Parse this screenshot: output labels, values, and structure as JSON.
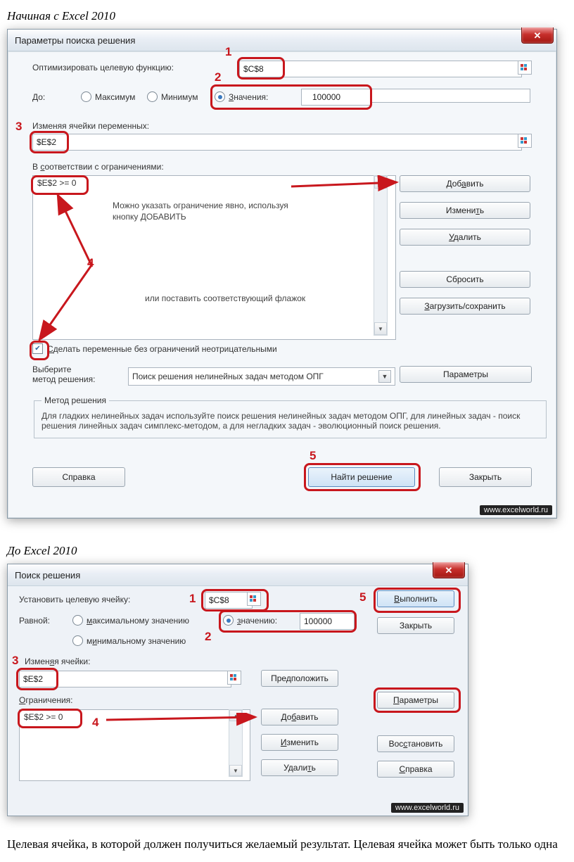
{
  "headings": {
    "after2010": "Начиная с Excel 2010",
    "before2010": "До Excel 2010",
    "bottom_text": "Целевая ячейка, в которой должен получиться желаемый результат. Целевая ячейка может быть только одна"
  },
  "dialog1": {
    "title": "Параметры поиска решения",
    "optimize_label": "Оптимизировать целевую функцию:",
    "objective_value": "$C$8",
    "to_label": "До:",
    "radio_max": "Максимум",
    "radio_min": "Минимум",
    "radio_value": "Значения:",
    "value_number": "100000",
    "vars_label": "Изменяя ячейки переменных:",
    "vars_value": "$E$2",
    "constraints_label": "В соответствии с ограничениями:",
    "constraint_item": "$E$2 >= 0",
    "ann_text1_l1": "Можно указать ограничение явно, используя",
    "ann_text1_l2": "кнопку ДОБАВИТЬ",
    "ann_text2": "или поставить соответствующий флажок",
    "checkbox_label": "Сделать переменные без ограничений неотрицательными",
    "select_label_l1": "Выберите",
    "select_label_l2": "метод решения:",
    "select_value": "Поиск решения нелинейных задач методом ОПГ",
    "method_legend": "Метод решения",
    "method_text": "Для гладких нелинейных задач используйте поиск решения нелинейных задач методом ОПГ, для линейных задач - поиск решения линейных задач симплекс-методом, а для негладких задач - эволюционный поиск решения.",
    "btn_add": "Добавить",
    "btn_change": "Изменить",
    "btn_delete": "Удалить",
    "btn_reset": "Сбросить",
    "btn_loadsave": "Загрузить/сохранить",
    "btn_params": "Параметры",
    "btn_help": "Справка",
    "btn_find": "Найти решение",
    "btn_close": "Закрыть"
  },
  "dialog2": {
    "title": "Поиск решения",
    "target_label": "Установить целевую ячейку:",
    "target_value": "$C$8",
    "equal_label": "Равной:",
    "radio_max": "максимальному значению",
    "radio_min": "минимальному значению",
    "radio_value": "значению:",
    "value_number": "100000",
    "vars_label": "Изменяя ячейки:",
    "vars_value": "$E$2",
    "constraints_label": "Ограничения:",
    "constraint_item": "$E$2 >= 0",
    "btn_assume": "Предположить",
    "btn_add": "Добавить",
    "btn_change": "Изменить",
    "btn_delete": "Удалить",
    "btn_run": "Выполнить",
    "btn_close": "Закрыть",
    "btn_params": "Параметры",
    "btn_reset": "Восстановить",
    "btn_help": "Справка"
  },
  "callouts": {
    "n1": "1",
    "n2": "2",
    "n3": "3",
    "n4": "4",
    "n5": "5"
  },
  "watermark": "www.excelworld.ru"
}
